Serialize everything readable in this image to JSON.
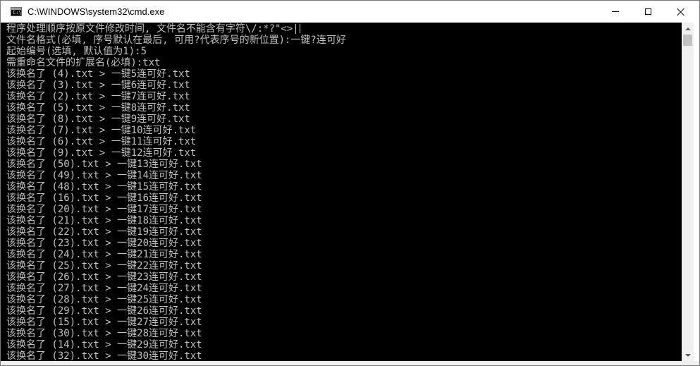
{
  "window": {
    "title": "C:\\WINDOWS\\system32\\cmd.exe",
    "icon": "cmd-icon",
    "icon_text": "C:\\",
    "controls": [
      "minimize-icon",
      "maximize-icon",
      "close-icon"
    ]
  },
  "console": {
    "foreground": "#c0c0c0",
    "background": "#000000",
    "lines": [
      "程序处理顺序按原文件修改时间, 文件名不能含有字符\\/:*?\"<>|",
      "文件名格式(必填, 序号默认在最后, 可用?代表序号的新位置):一键?连可好",
      "起始编号(选填, 默认值为1):5",
      "需重命名文件的扩展名(必填):txt",
      "该换名了 (4).txt > 一键5连可好.txt",
      "该换名了 (3).txt > 一键6连可好.txt",
      "该换名了 (2).txt > 一键7连可好.txt",
      "该换名了 (5).txt > 一键8连可好.txt",
      "该换名了 (8).txt > 一键9连可好.txt",
      "该换名了 (7).txt > 一键10连可好.txt",
      "该换名了 (6).txt > 一键11连可好.txt",
      "该换名了 (9).txt > 一键12连可好.txt",
      "该换名了 (50).txt > 一键13连可好.txt",
      "该换名了 (49).txt > 一键14连可好.txt",
      "该换名了 (48).txt > 一键15连可好.txt",
      "该换名了 (16).txt > 一键16连可好.txt",
      "该换名了 (20).txt > 一键17连可好.txt",
      "该换名了 (21).txt > 一键18连可好.txt",
      "该换名了 (22).txt > 一键19连可好.txt",
      "该换名了 (23).txt > 一键20连可好.txt",
      "该换名了 (24).txt > 一键21连可好.txt",
      "该换名了 (25).txt > 一键22连可好.txt",
      "该换名了 (26).txt > 一键23连可好.txt",
      "该换名了 (27).txt > 一键24连可好.txt",
      "该换名了 (28).txt > 一键25连可好.txt",
      "该换名了 (29).txt > 一键26连可好.txt",
      "该换名了 (15).txt > 一键27连可好.txt",
      "该换名了 (30).txt > 一键28连可好.txt",
      "该换名了 (14).txt > 一键29连可好.txt",
      "该换名了 (32).txt > 一键30连可好.txt"
    ]
  },
  "scrollbar": {
    "up_icon": "arrow-up-icon",
    "down_icon": "arrow-down-icon"
  }
}
